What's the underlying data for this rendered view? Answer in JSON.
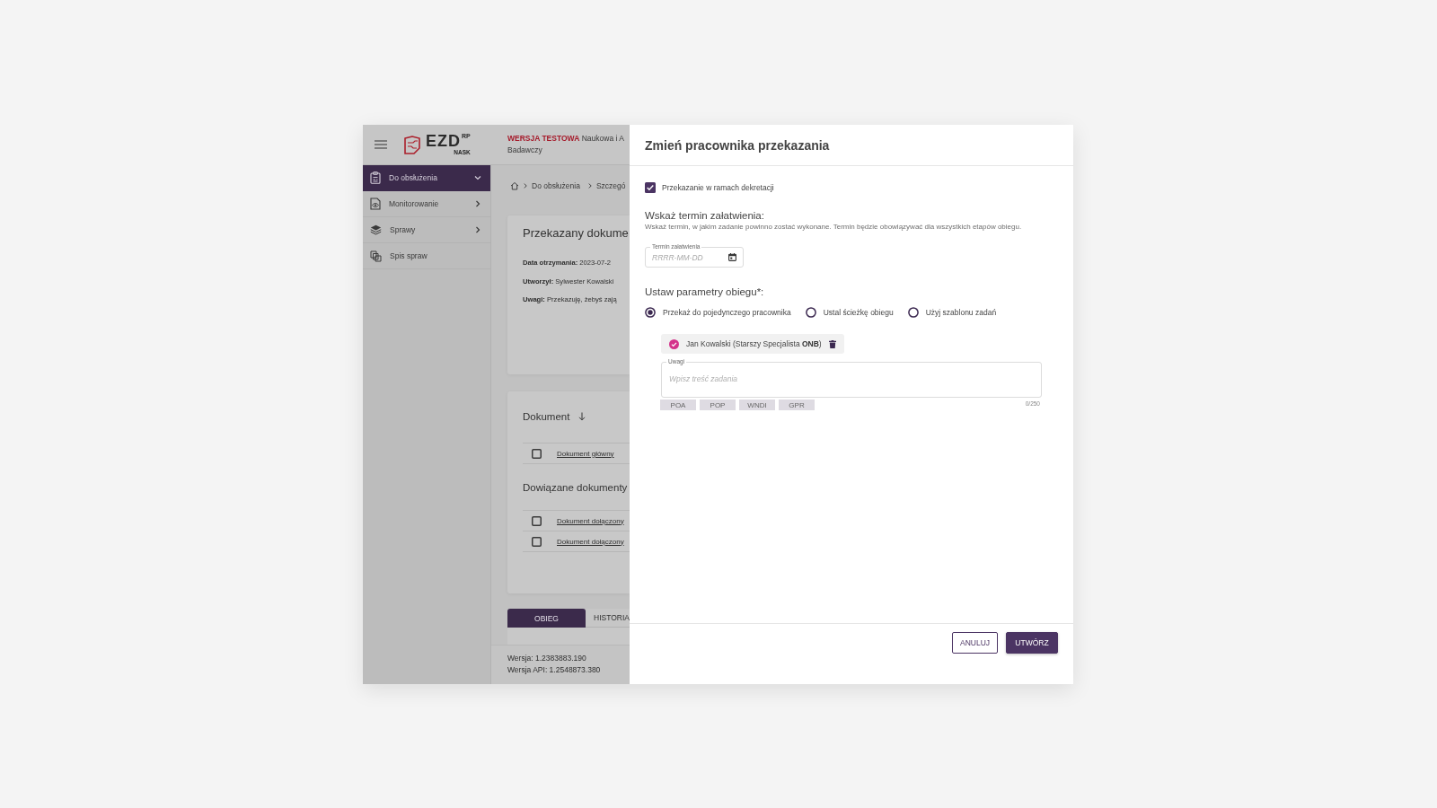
{
  "app": {
    "logo": {
      "name": "EZD",
      "superscript": "RP",
      "subtitle": "NASK"
    },
    "header": {
      "badge": "WERSJA TESTOWA",
      "organization_line_1": "Naukowa i A",
      "organization_line_2": "Badawczy"
    },
    "sidebar": {
      "items": [
        {
          "label": "Do obsłużenia",
          "kind": "group",
          "selected": true,
          "expanded": true
        },
        {
          "label": "Monitorowanie",
          "kind": "group",
          "selected": false,
          "expanded": false
        },
        {
          "label": "Sprawy",
          "kind": "group",
          "selected": false,
          "expanded": false
        },
        {
          "label": "Spis spraw",
          "kind": "link",
          "selected": false
        }
      ]
    },
    "breadcrumb": [
      "Do obsłużenia",
      "Szczegó"
    ],
    "details_card": {
      "title": "Przekazany dokume",
      "fields": [
        "**Data otrzymania:** 2023-07-2",
        "**Utworzył:** Sylwester Kowalski",
        "**Uwagi:** Przekazuję, żebyś zają"
      ]
    },
    "documents_card": {
      "heading": "Dokument",
      "main_documents": [
        {
          "label": "Dokument główny",
          "checked": false
        }
      ],
      "related_heading": "Dowiązane dokumenty",
      "related_documents": [
        {
          "label": "Dokument dołączony",
          "checked": false
        },
        {
          "label": "Dokument dołączony",
          "checked": false
        }
      ]
    },
    "tabs": [
      {
        "label": "OBIEG",
        "selected": true
      },
      {
        "label": "HISTORIA",
        "selected": false
      }
    ],
    "footer": {
      "version": "Wersja: 1.2383883.190",
      "api_version": "Wersja API: 1.2548873.380"
    }
  },
  "dialog": {
    "title": "Zmień pracownika przekazania",
    "decree_checkbox": {
      "label": "Przekazanie w ramach dekretacji",
      "checked": true
    },
    "deadline": {
      "heading": "Wskaż termin załatwienia:",
      "hint": "Wskaż termin, w jakim zadanie powinno zostać wykonane. Termin będzie obowiązywać dla wszystkich etapów obiegu.",
      "field": {
        "label": "Termin załatwienia",
        "placeholder": "RRRR-MM-DD"
      }
    },
    "routing": {
      "heading": "Ustaw parametry obiegu*:",
      "options": [
        {
          "label": "Przekaż do pojedynczego pracownika",
          "selected": true
        },
        {
          "label": "Ustal ścieżkę obiegu",
          "selected": false
        },
        {
          "label": "Użyj szablonu zadań",
          "selected": false
        }
      ]
    },
    "assignee": {
      "text": "Jan Kowalski (Starszy Specjalista **ONB**)"
    },
    "notes": {
      "label": "Uwagi",
      "placeholder": "Wpisz treść zadania",
      "counter": "0/250"
    },
    "tags": [
      "POA",
      "POP",
      "WNDI",
      "GPR"
    ],
    "buttons": [
      {
        "label": "ANULUJ",
        "kind": "secondary"
      },
      {
        "label": "UTWÓRZ",
        "kind": "primary"
      }
    ]
  }
}
